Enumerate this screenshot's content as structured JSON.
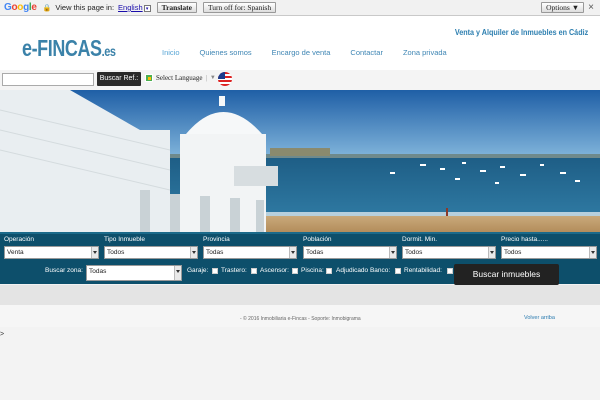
{
  "translate_bar": {
    "logo": "Google",
    "view_text": "View this page in:",
    "language": "English",
    "translate_label": "Translate",
    "turn_off_label": "Turn off for: Spanish",
    "options_label": "Options ▼",
    "close_glyph": "×"
  },
  "header": {
    "logo_main": "e-FINCAS",
    "logo_suffix": ".es",
    "tagline": "Venta y Alquiler de Inmuebles en Cádiz",
    "nav": [
      "Inicio",
      "Quienes somos",
      "Encargo de venta",
      "Contactar",
      "Zona privada"
    ],
    "active_nav": "Inicio"
  },
  "search_strip": {
    "ref_placeholder": "",
    "ref_button": "Buscar Ref.:",
    "language_select": "Select Language",
    "language_separator": "|",
    "language_arrow": "▼"
  },
  "search_panel": {
    "fields": [
      {
        "label": "Operación",
        "value": "Venta"
      },
      {
        "label": "Tipo Inmueble",
        "value": "Todos"
      },
      {
        "label": "Provincia",
        "value": "Todas"
      },
      {
        "label": "Población",
        "value": "Todas"
      },
      {
        "label": "Dormit. Min.",
        "value": "Todos"
      },
      {
        "label": "Precio hasta......",
        "value": "Todos"
      }
    ],
    "zone_label": "Buscar zona:",
    "zone_value": "Todas",
    "checkboxes": [
      "Garaje:",
      "Trastero:",
      "Ascensor:",
      "Piscina:",
      "Adjudicado Banco:",
      "Rentabilidad:"
    ],
    "search_button": "Buscar inmuebles"
  },
  "footer": {
    "copyright": "- © 2016 Inmobiliaria e-Fincas - Soporte: Inmobigrama",
    "back_to_top": "Volver arriba"
  },
  "stray_text": ">",
  "colors": {
    "brand_blue": "#3b82a9",
    "panel_bg": "#0d4f6b",
    "button_dark": "#222222"
  }
}
